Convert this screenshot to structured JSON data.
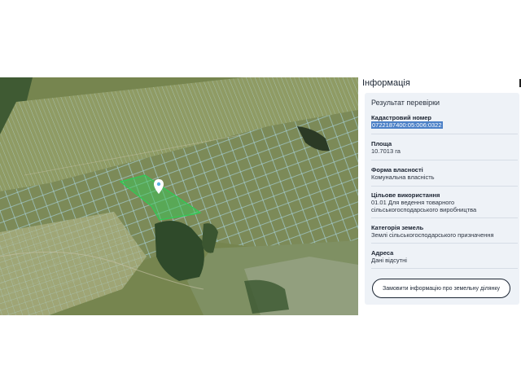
{
  "panel": {
    "title": "Інформація"
  },
  "result": {
    "title": "Результат перевірки",
    "fields": [
      {
        "label": "Кадастровий номер",
        "value": "0722187400:05:006:0322"
      },
      {
        "label": "Площа",
        "value": "10.7013 га"
      },
      {
        "label": "Форма власності",
        "value": "Комунальна власність"
      },
      {
        "label": "Цільове використання",
        "value": "01.01 Для ведення товарного сільськогосподарського виробництва"
      },
      {
        "label": "Категорія земель",
        "value": "Землі сільськогосподарського призначення"
      },
      {
        "label": "Адреса",
        "value": "Дані відсутні"
      }
    ],
    "order_button": "Замовити інформацію про земельну ділянку"
  },
  "map": {
    "marker_icon": "map-pin-icon",
    "selected_parcel_color": "#2ecc55",
    "parcel_outline_color": "#a9d6e5"
  }
}
